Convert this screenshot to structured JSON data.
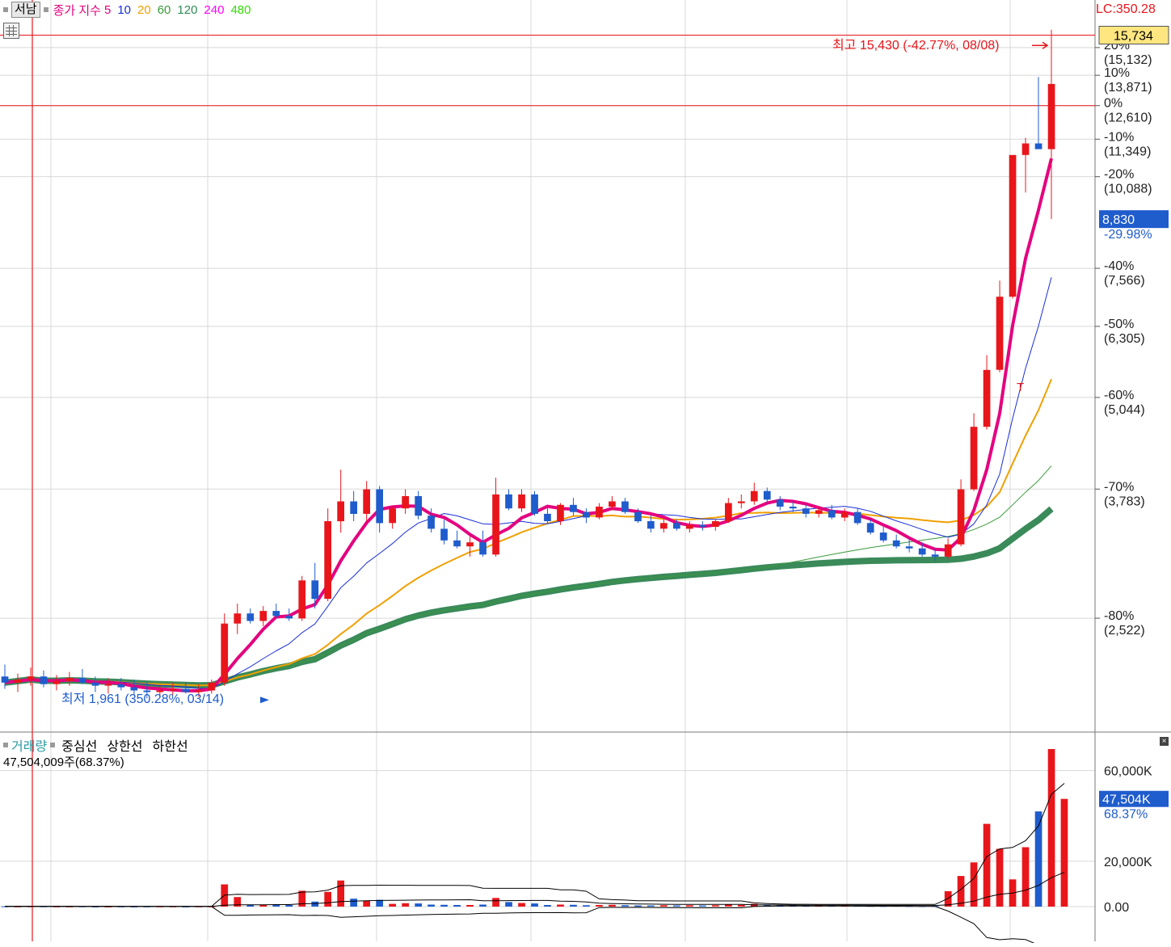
{
  "header": {
    "stock_name": "서남",
    "indicator_label": "종가 지수",
    "ma_periods": [
      "5",
      "10",
      "20",
      "60",
      "120",
      "240",
      "480"
    ],
    "ma_colors": [
      "#e4007f",
      "#1a2fd6",
      "#f0a000",
      "#3a9a3a",
      "#2e8b57",
      "#ff00ff",
      "#33dd00"
    ]
  },
  "price_axis": {
    "lc_label": "LC:350.28",
    "top_value": "15,734",
    "current_price": "8,830",
    "current_pct": "-29.98%",
    "ticks": [
      {
        "pct": "20%",
        "price": "(15,132)",
        "value": 15132
      },
      {
        "pct": "10%",
        "price": "(13,871)",
        "value": 13871
      },
      {
        "pct": "0%",
        "price": "(12,610)",
        "value": 12610
      },
      {
        "pct": "-10%",
        "price": "(11,349)",
        "value": 11349
      },
      {
        "pct": "-20%",
        "price": "(10,088)",
        "value": 10088
      },
      {
        "pct": "-40%",
        "price": "(7,566)",
        "value": 7566
      },
      {
        "pct": "-50%",
        "price": "(6,305)",
        "value": 6305
      },
      {
        "pct": "-60%",
        "price": "(5,044)",
        "value": 5044
      },
      {
        "pct": "-70%",
        "price": "(3,783)",
        "value": 3783
      },
      {
        "pct": "-80%",
        "price": "(2,522)",
        "value": 2522
      }
    ]
  },
  "annotations": {
    "high_label": "최고 15,430 (-42.77%, 08/08)",
    "low_label": "최저 1,961 (350.28%, 03/14)",
    "t_marker": "T"
  },
  "volume": {
    "legend_title": "거래량",
    "legend_items": [
      "중심선",
      "상한선",
      "하한선"
    ],
    "value_label": "47,504,009주(68.37%)",
    "axis_ticks": [
      {
        "label": "60,000K",
        "value": 60000
      },
      {
        "label": "20,000K",
        "value": 20000
      },
      {
        "label": "0.00",
        "value": 0
      }
    ],
    "current_label": "47,504K",
    "current_pct": "68.37%"
  },
  "colors": {
    "up": "#e8161b",
    "down": "#1f5ccc",
    "ref_line": "#e8161b",
    "grid": "#d8d8d8",
    "highlight_box": "#ffe680"
  },
  "chart_data": {
    "type": "candlestick",
    "price_unit": "KRW",
    "ylim": [
      1800,
      16200
    ],
    "reference_lines": [
      15734,
      12610
    ],
    "highlight_price": 8830,
    "high": 15430,
    "low": 1961,
    "candles_ohlc": [
      [
        2100,
        2180,
        2020,
        2060
      ],
      [
        2060,
        2120,
        2000,
        2080
      ],
      [
        2080,
        2160,
        2040,
        2100
      ],
      [
        2100,
        2140,
        2030,
        2050
      ],
      [
        2050,
        2110,
        2010,
        2070
      ],
      [
        2070,
        2130,
        2040,
        2090
      ],
      [
        2090,
        2150,
        2050,
        2060
      ],
      [
        2060,
        2100,
        2000,
        2040
      ],
      [
        2040,
        2090,
        1990,
        2050
      ],
      [
        2050,
        2090,
        2010,
        2030
      ],
      [
        2030,
        2080,
        1980,
        2010
      ],
      [
        2010,
        2060,
        1961,
        2000
      ],
      [
        2000,
        2040,
        1970,
        2010
      ],
      [
        2010,
        2060,
        1980,
        2020
      ],
      [
        2020,
        2060,
        1990,
        2000
      ],
      [
        2000,
        2050,
        1970,
        2010
      ],
      [
        2010,
        2080,
        1990,
        2060
      ],
      [
        2060,
        2560,
        2040,
        2480
      ],
      [
        2480,
        2640,
        2400,
        2560
      ],
      [
        2560,
        2600,
        2480,
        2500
      ],
      [
        2500,
        2620,
        2460,
        2580
      ],
      [
        2580,
        2640,
        2520,
        2540
      ],
      [
        2540,
        2600,
        2500,
        2520
      ],
      [
        2520,
        2880,
        2500,
        2840
      ],
      [
        2840,
        3000,
        2600,
        2680
      ],
      [
        2680,
        3560,
        2660,
        3420
      ],
      [
        3420,
        4020,
        3300,
        3640
      ],
      [
        3640,
        3760,
        3420,
        3500
      ],
      [
        3500,
        3880,
        3420,
        3780
      ],
      [
        3780,
        3820,
        3300,
        3400
      ],
      [
        3400,
        3580,
        3340,
        3560
      ],
      [
        3560,
        3780,
        3500,
        3700
      ],
      [
        3700,
        3760,
        3440,
        3480
      ],
      [
        3480,
        3560,
        3300,
        3340
      ],
      [
        3340,
        3440,
        3180,
        3220
      ],
      [
        3220,
        3320,
        3140,
        3160
      ],
      [
        3160,
        3260,
        3060,
        3200
      ],
      [
        3200,
        3320,
        3060,
        3080
      ],
      [
        3080,
        3920,
        3060,
        3720
      ],
      [
        3720,
        3780,
        3540,
        3560
      ],
      [
        3560,
        3780,
        3520,
        3720
      ],
      [
        3720,
        3760,
        3480,
        3500
      ],
      [
        3500,
        3600,
        3400,
        3420
      ],
      [
        3420,
        3620,
        3380,
        3600
      ],
      [
        3600,
        3680,
        3480,
        3520
      ],
      [
        3520,
        3560,
        3400,
        3460
      ],
      [
        3460,
        3620,
        3440,
        3580
      ],
      [
        3580,
        3700,
        3540,
        3640
      ],
      [
        3640,
        3680,
        3500,
        3520
      ],
      [
        3520,
        3560,
        3400,
        3420
      ],
      [
        3420,
        3480,
        3300,
        3340
      ],
      [
        3340,
        3440,
        3300,
        3400
      ],
      [
        3400,
        3440,
        3320,
        3340
      ],
      [
        3340,
        3420,
        3300,
        3380
      ],
      [
        3380,
        3420,
        3320,
        3360
      ],
      [
        3360,
        3440,
        3320,
        3420
      ],
      [
        3420,
        3680,
        3400,
        3620
      ],
      [
        3620,
        3720,
        3560,
        3640
      ],
      [
        3640,
        3860,
        3600,
        3760
      ],
      [
        3760,
        3800,
        3620,
        3660
      ],
      [
        3660,
        3700,
        3540,
        3580
      ],
      [
        3580,
        3640,
        3520,
        3560
      ],
      [
        3560,
        3600,
        3460,
        3500
      ],
      [
        3500,
        3580,
        3460,
        3540
      ],
      [
        3540,
        3600,
        3440,
        3460
      ],
      [
        3460,
        3560,
        3420,
        3520
      ],
      [
        3520,
        3560,
        3380,
        3400
      ],
      [
        3400,
        3440,
        3280,
        3300
      ],
      [
        3300,
        3360,
        3200,
        3220
      ],
      [
        3220,
        3280,
        3140,
        3160
      ],
      [
        3160,
        3240,
        3100,
        3140
      ],
      [
        3140,
        3200,
        3060,
        3080
      ],
      [
        3080,
        3140,
        3020,
        3060
      ],
      [
        3060,
        3240,
        3040,
        3180
      ],
      [
        3180,
        3900,
        3160,
        3780
      ],
      [
        3780,
        4800,
        3760,
        4600
      ],
      [
        4600,
        5760,
        4560,
        5500
      ],
      [
        5500,
        7280,
        5460,
        6920
      ],
      [
        6920,
        10200,
        6880,
        10800
      ],
      [
        10800,
        11400,
        9600,
        11200
      ],
      [
        11200,
        13800,
        11100,
        11000
      ],
      [
        11000,
        16000,
        8830,
        13500
      ]
    ],
    "volume_series": [
      {
        "name": "거래량",
        "unit": "thousand shares",
        "values": [
          120,
          80,
          100,
          90,
          70,
          60,
          90,
          50,
          40,
          60,
          50,
          80,
          60,
          70,
          50,
          60,
          80,
          9800,
          4200,
          900,
          700,
          900,
          700,
          7000,
          2200,
          6500,
          11500,
          3500,
          2600,
          3000,
          1200,
          1500,
          1400,
          900,
          800,
          700,
          700,
          900,
          3800,
          2000,
          1600,
          1400,
          700,
          900,
          800,
          600,
          700,
          800,
          600,
          500,
          500,
          600,
          500,
          600,
          500,
          600,
          900,
          700,
          1200,
          600,
          500,
          500,
          400,
          500,
          400,
          500,
          400,
          300,
          300,
          400,
          300,
          200,
          300,
          6800,
          13500,
          19500,
          36500,
          25500,
          12000,
          26200,
          42000,
          69500,
          47504
        ]
      }
    ]
  }
}
